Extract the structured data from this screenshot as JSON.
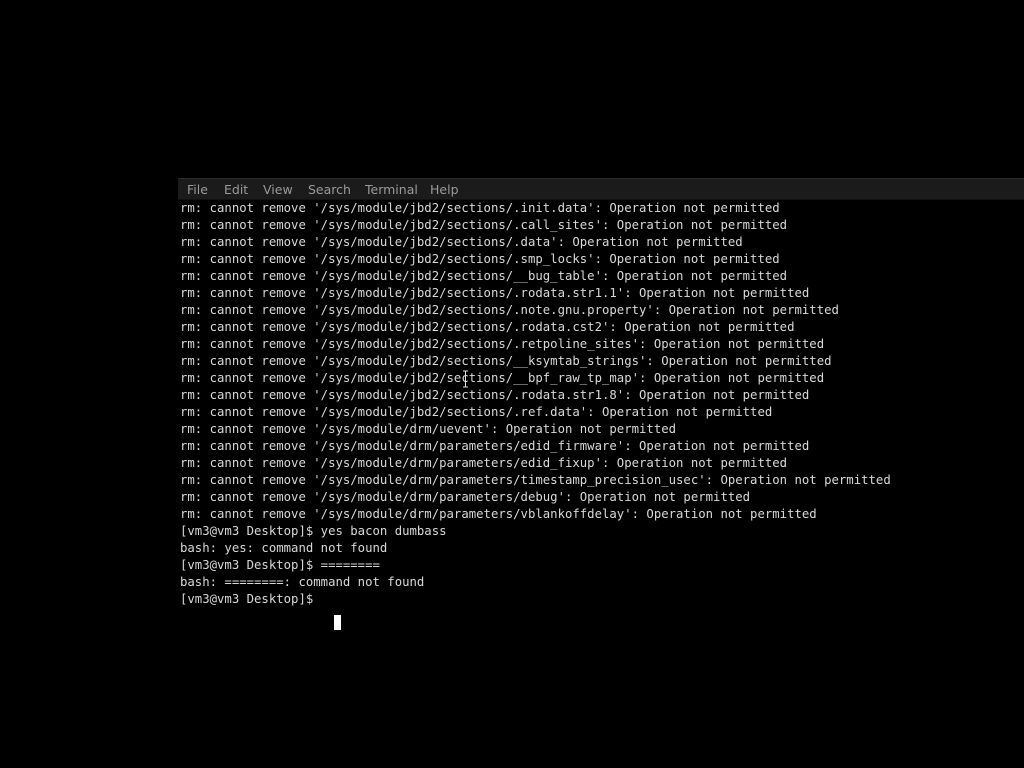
{
  "menu": {
    "file": "File",
    "edit": "Edit",
    "view": "View",
    "search": "Search",
    "terminal": "Terminal",
    "help": "Help"
  },
  "lines": [
    "rm: cannot remove '/sys/module/jbd2/sections/.init.data': Operation not permitted",
    "rm: cannot remove '/sys/module/jbd2/sections/.call_sites': Operation not permitted",
    "rm: cannot remove '/sys/module/jbd2/sections/.data': Operation not permitted",
    "rm: cannot remove '/sys/module/jbd2/sections/.smp_locks': Operation not permitted",
    "rm: cannot remove '/sys/module/jbd2/sections/__bug_table': Operation not permitted",
    "rm: cannot remove '/sys/module/jbd2/sections/.rodata.str1.1': Operation not permitted",
    "rm: cannot remove '/sys/module/jbd2/sections/.note.gnu.property': Operation not permitted",
    "rm: cannot remove '/sys/module/jbd2/sections/.rodata.cst2': Operation not permitted",
    "rm: cannot remove '/sys/module/jbd2/sections/.retpoline_sites': Operation not permitted",
    "rm: cannot remove '/sys/module/jbd2/sections/__ksymtab_strings': Operation not permitted",
    "rm: cannot remove '/sys/module/jbd2/sections/__bpf_raw_tp_map': Operation not permitted",
    "rm: cannot remove '/sys/module/jbd2/sections/.rodata.str1.8': Operation not permitted",
    "rm: cannot remove '/sys/module/jbd2/sections/.ref.data': Operation not permitted",
    "rm: cannot remove '/sys/module/drm/uevent': Operation not permitted",
    "rm: cannot remove '/sys/module/drm/parameters/edid_firmware': Operation not permitted",
    "rm: cannot remove '/sys/module/drm/parameters/edid_fixup': Operation not permitted",
    "rm: cannot remove '/sys/module/drm/parameters/timestamp_precision_usec': Operation not permitted",
    "rm: cannot remove '/sys/module/drm/parameters/debug': Operation not permitted",
    "rm: cannot remove '/sys/module/drm/parameters/vblankoffdelay': Operation not permitted",
    "[vm3@vm3 Desktop]$ yes bacon dumbass",
    "bash: yes: command not found",
    "[vm3@vm3 Desktop]$ ========",
    "bash: ========: command not found",
    "[vm3@vm3 Desktop]$ "
  ],
  "colors": {
    "background": "#000000",
    "menubar": "#1b1b1b",
    "menu_text": "#9a9a9a",
    "terminal_text": "#d8d8d8",
    "cursor": "#ffffff"
  },
  "icons": {
    "mouse_pointer": "text-ibeam-icon"
  }
}
